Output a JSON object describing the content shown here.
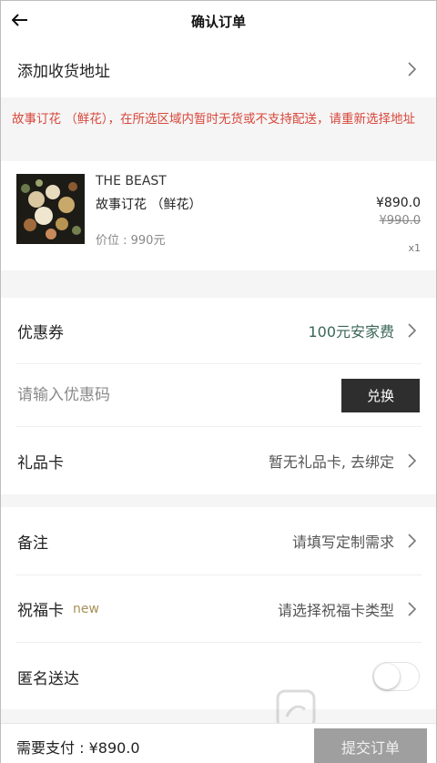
{
  "header": {
    "title": "确认订单",
    "back_icon": "arrow-left-icon"
  },
  "address": {
    "label": "添加收货地址"
  },
  "warning": {
    "text": "故事订花 （鲜花），在所选区域内暂时无货或不支持配送，请重新选择地址"
  },
  "product": {
    "brand": "THE BEAST",
    "name": "故事订花 （鲜花）",
    "price_label": "价位 : 990元",
    "price": "¥890.0",
    "original_price": "¥990.0",
    "quantity": "x1"
  },
  "coupon": {
    "label": "优惠券",
    "value": "100元安家费",
    "value_color": "#3b6658"
  },
  "promo": {
    "placeholder": "请输入优惠码",
    "redeem_label": "兑换"
  },
  "gift_card": {
    "label": "礼品卡",
    "value": "暂无礼品卡, 去绑定"
  },
  "note": {
    "label": "备注",
    "value": "请填写定制需求"
  },
  "blessing_card": {
    "label": "祝福卡",
    "badge": "new",
    "value": "请选择祝福卡类型"
  },
  "anonymous": {
    "label": "匿名送达",
    "enabled": false
  },
  "footer": {
    "pay_label": "需要支付 :",
    "pay_amount": "¥890.0",
    "submit_label": "提交订单"
  },
  "colors": {
    "warning_text": "#d8473b",
    "accent_new": "#a89056",
    "dark_button": "#2e2e2e",
    "submit_disabled": "#9f9f9f"
  }
}
